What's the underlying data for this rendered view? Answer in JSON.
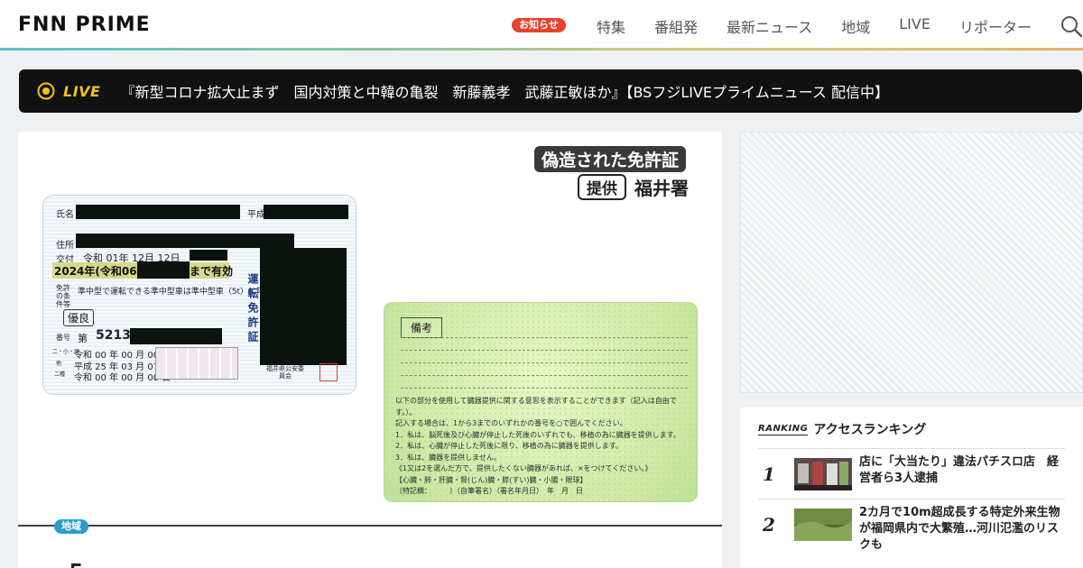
{
  "header": {
    "logo_text": "FNN PRIME",
    "notice_badge": "お知らせ",
    "nav": [
      "特集",
      "番組発",
      "最新ニュース",
      "地域",
      "LIVE",
      "リポーター"
    ]
  },
  "live_bar": {
    "label": "LIVE",
    "title": "『新型コロナ拡大止まず　国内対策と中韓の亀裂　新藤義孝　武藤正敏ほか』【BSフジLIVEプライムニュース 配信中】"
  },
  "article": {
    "hero_label": "偽造された免許証",
    "provider_label": "提供",
    "provider_name": "福井署",
    "tag": "地域",
    "license_front": {
      "name_label": "氏名",
      "era_label": "平成",
      "address_label": "住所",
      "issue_label": "交付",
      "issue_date": "令和 01年 12月 12日",
      "expiry_prefix": "2024年(令和06年",
      "expiry_suffix": "まで有効",
      "conditions_label": "免許の条件等",
      "conditions": "準中型で運転できる準中型車は準中型車（5t）に限る",
      "grade": "優良",
      "number_label": "番号",
      "number_prefix": "第",
      "number_visible": "5213",
      "other_label": "二・小・原",
      "other_date": "令和 00 年 00 月 00 日",
      "other2_label": "他",
      "other2_date": "平成 25 年 03 月 07 日",
      "class2_label": "二種",
      "class2_date": "令和 00 年 00 月 00 日",
      "vertical": "運転免許証",
      "issuer": "福井県公安委員会"
    },
    "license_back": {
      "biko": "備考",
      "organ_text": [
        "以下の部分を使用して臓器提供に関する意思を表示することができます（記入は自由です。）。",
        "記入する場合は、1から3までのいずれかの番号を○で囲んでください。",
        "1．私は、脳死後及び心臓が停止した死後のいずれでも、移植の為に臓器を提供します。",
        "2．私は、心臓が停止した死後に限り、移植の為に臓器を提供します。",
        "3．私は、臓器を提供しません。",
        "《1又は2を選んだ方で、提供したくない臓器があれば、×をつけてください。》",
        "【心臓・肺・肝臓・腎(じん)臓・膵(すい)臓・小腸・眼球】",
        "〔特記欄：　　　〕（自筆署名）（署名年月日）　年　月　日"
      ]
    },
    "title_partial": "「"
  },
  "ranking": {
    "badge": "RANKING",
    "title": "アクセスランキング",
    "items": [
      {
        "rank": "1",
        "text": "店に「大当たり」違法パチスロ店　経営者ら3人逮捕"
      },
      {
        "rank": "2",
        "text": "2カ月で10m超成長する特定外来生物が福岡県内で大繁殖…河川氾濫のリスクも"
      }
    ]
  }
}
